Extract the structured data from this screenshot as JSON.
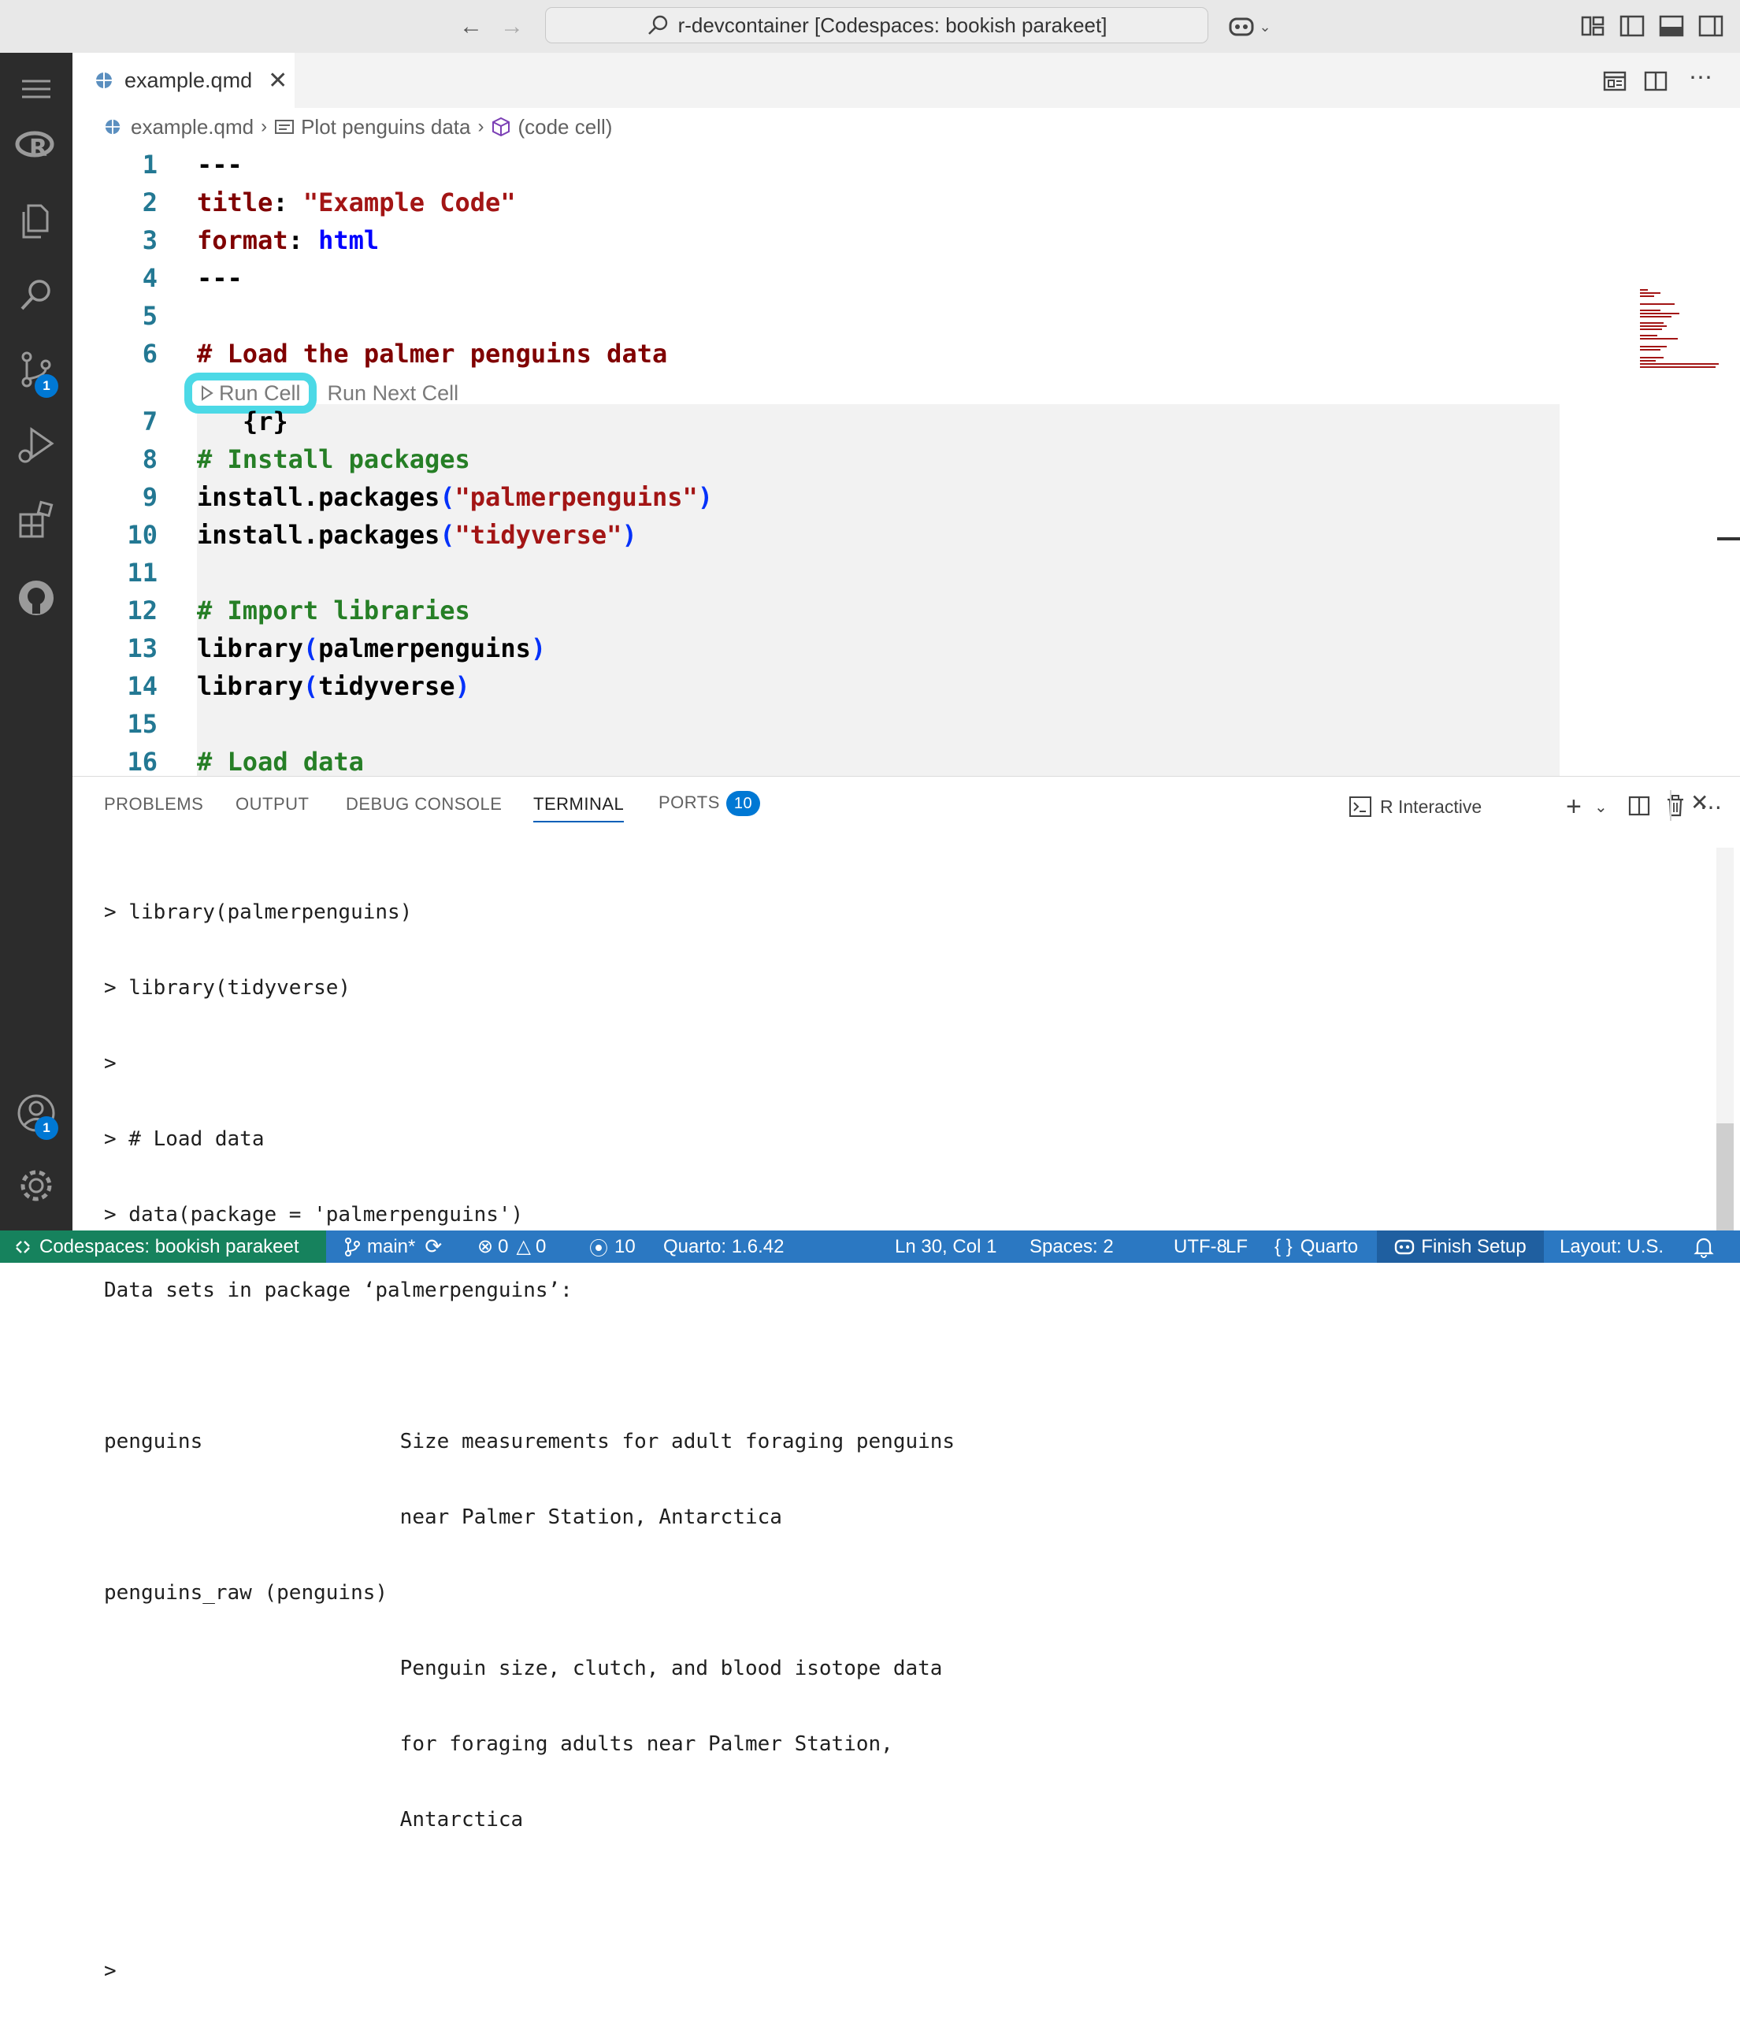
{
  "titlebar": {
    "command_center": "r-devcontainer [Codespaces: bookish parakeet]"
  },
  "activity_bar": {
    "source_control_badge": "1",
    "accounts_badge": "1"
  },
  "tab": {
    "label": "example.qmd"
  },
  "breadcrumb": {
    "file": "example.qmd",
    "section": "Plot penguins data",
    "cell": "(code cell)"
  },
  "code_lens": {
    "run_cell": "Run Cell",
    "run_next_cell": "Run Next Cell"
  },
  "editor": {
    "lines": [
      {
        "n": "1"
      },
      {
        "n": "2"
      },
      {
        "n": "3"
      },
      {
        "n": "4"
      },
      {
        "n": "5"
      },
      {
        "n": "6"
      },
      {
        "n": "7"
      },
      {
        "n": "8"
      },
      {
        "n": "9"
      },
      {
        "n": "10"
      },
      {
        "n": "11"
      },
      {
        "n": "12"
      },
      {
        "n": "13"
      },
      {
        "n": "14"
      },
      {
        "n": "15"
      },
      {
        "n": "16"
      }
    ],
    "l1": "---",
    "l2_key": "title",
    "l2_colon": ": ",
    "l2_val": "\"Example Code\"",
    "l3_key": "format",
    "l3_colon": ": ",
    "l3_val": "html",
    "l4": "---",
    "l6": "# Load the palmer penguins data",
    "l7": "{r}",
    "l8": "# Install packages",
    "l9_fn": "install.packages",
    "l9_arg": "\"palmerpenguins\"",
    "l10_fn": "install.packages",
    "l10_arg": "\"tidyverse\"",
    "l12": "# Import libraries",
    "l13_fn": "library",
    "l13_arg": "palmerpenguins",
    "l14_fn": "library",
    "l14_arg": "tidyverse",
    "l16": "# Load data",
    "paren_open": "(",
    "paren_close": ")"
  },
  "panel": {
    "tabs": {
      "problems": "PROBLEMS",
      "output": "OUTPUT",
      "debug_console": "DEBUG CONSOLE",
      "terminal": "TERMINAL",
      "ports": "PORTS",
      "ports_count": "10"
    },
    "terminal_name": "R Interactive",
    "terminal_lines": [
      "> library(palmerpenguins)",
      "> library(tidyverse)",
      ">",
      "> # Load data",
      "> data(package = 'palmerpenguins')",
      "Data sets in package ‘palmerpenguins’:",
      "",
      "penguins                Size measurements for adult foraging penguins",
      "                        near Palmer Station, Antarctica",
      "penguins_raw (penguins)",
      "                        Penguin size, clutch, and blood isotope data",
      "                        for foraging adults near Palmer Station,",
      "                        Antarctica",
      "",
      ">"
    ]
  },
  "statusbar": {
    "remote": "Codespaces: bookish parakeet",
    "branch": "main*",
    "errors": "0",
    "warnings": "0",
    "ports": "10",
    "quarto_version": "Quarto: 1.6.42",
    "position": "Ln 30, Col 1",
    "spaces": "Spaces: 2",
    "encoding": "UTF-8",
    "eol": "LF",
    "language": "Quarto",
    "finish_setup": "Finish Setup",
    "layout": "Layout: U.S."
  },
  "colors": {
    "activity_bg": "#2c2c2c",
    "status_bg": "#2b78c2",
    "remote_bg": "#16825d",
    "highlight_ring": "#4cd9e6"
  }
}
